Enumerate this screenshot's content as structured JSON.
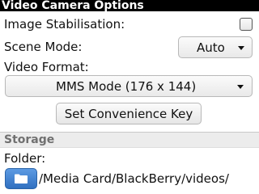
{
  "title": "Video Camera Options",
  "image_stabilisation": {
    "label": "Image Stabilisation:",
    "checked": false
  },
  "scene_mode": {
    "label": "Scene Mode:",
    "value": "Auto"
  },
  "video_format": {
    "label": "Video Format:",
    "value": "MMS Mode (176 x 144)"
  },
  "convenience_key_button": "Set Convenience Key",
  "storage": {
    "section_title": "Storage",
    "folder_label": "Folder:",
    "folder_path": "/Media Card/BlackBerry/videos/",
    "folder_icon": "folder-icon"
  }
}
